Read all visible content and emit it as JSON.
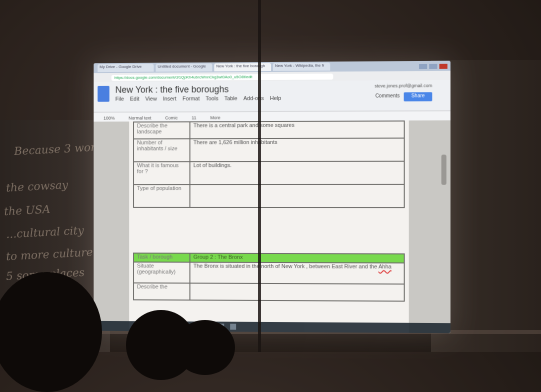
{
  "browser": {
    "tabs": [
      "My Drive - Google Drive",
      "Untitled document - Google",
      "New York : the five borough",
      "New York - Wikipedia, the fr"
    ],
    "url": "https://docs.google.com/document/d/1QpKh4ubrcWnnCkg3wt0Ao0_u5O8t/edit"
  },
  "docs": {
    "title": "New York : the five boroughs",
    "menu": [
      "File",
      "Edit",
      "View",
      "Insert",
      "Format",
      "Tools",
      "Table",
      "Add-ons",
      "Help"
    ],
    "user_email": "steve.jones.prof@gmail.com",
    "comments_label": "Comments",
    "share_label": "Share",
    "toolbar": [
      "100%",
      "Normal text",
      "Comic",
      "11",
      "More"
    ]
  },
  "table1": {
    "rows": [
      {
        "label": "Describe the landscape",
        "value": "There is a central park and some squares"
      },
      {
        "label": "Number of inhabitants / size",
        "value": "There are 1,626 million inhabitants"
      },
      {
        "label": "What it is famous for ?",
        "value": "Lot of buildings."
      },
      {
        "label": "Type of population",
        "value": ""
      }
    ]
  },
  "table2": {
    "header": {
      "label": "Task / borough",
      "value": "Group 2 : The Bronx"
    },
    "rows": [
      {
        "label": "Situate (geographically)",
        "value_prefix": "The Bronx is situated in the north of New York , between East River and the ",
        "value_flagged": "Ahha"
      },
      {
        "label": "Describe the",
        "value": ""
      }
    ]
  },
  "whiteboard": [
    "Because 3 wonderful",
    "the cowsay",
    "the USA",
    "...cultural city",
    "to more culture",
    "5 some places"
  ]
}
